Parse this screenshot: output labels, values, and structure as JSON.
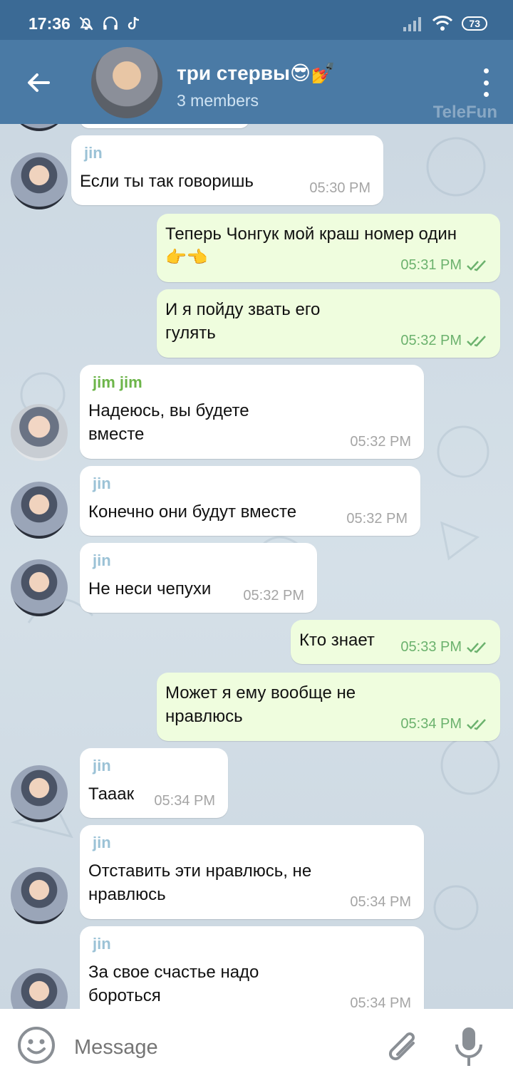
{
  "status_bar": {
    "time": "17:36",
    "battery": "73"
  },
  "header": {
    "title": "три стервы😎💅",
    "subtitle": "3 members",
    "watermark": "TeleFun"
  },
  "messages": [
    {
      "sender": "jin",
      "text": "Если ты так говоришь",
      "time": "05:30 PM"
    },
    {
      "text": "Теперь Чонгук мой краш номер один👉👈",
      "time": "05:31 PM",
      "status": "read"
    },
    {
      "text": "И я пойду звать его гулять",
      "time": "05:32 PM",
      "status": "read"
    },
    {
      "sender": "jim jim",
      "text": "Надеюсь, вы будете вместе",
      "time": "05:32 PM"
    },
    {
      "sender": "jin",
      "text": "Конечно они будут вместе",
      "time": "05:32 PM"
    },
    {
      "sender": "jin",
      "text": "Не неси чепухи",
      "time": "05:32 PM"
    },
    {
      "text": "Кто знает",
      "time": "05:33 PM",
      "status": "read"
    },
    {
      "text": "Может я ему вообще не нравлюсь",
      "time": "05:34 PM",
      "status": "read"
    },
    {
      "sender": "jin",
      "text": "Тааак",
      "time": "05:34 PM"
    },
    {
      "sender": "jin",
      "text": "Отставить эти нравлюсь, не нравлюсь",
      "time": "05:34 PM"
    },
    {
      "sender": "jin",
      "text": "За свое счастье надо бороться",
      "time": "05:34 PM"
    }
  ],
  "input": {
    "placeholder": "Message"
  },
  "colors": {
    "header": "#4a7aa5",
    "status_bar": "#3b6a95",
    "outgoing_bubble": "#effdde",
    "incoming_bubble": "#ffffff",
    "sender_jin": "#9bc2d6",
    "sender_jim": "#6db54a",
    "read_check": "#6cb26e"
  }
}
